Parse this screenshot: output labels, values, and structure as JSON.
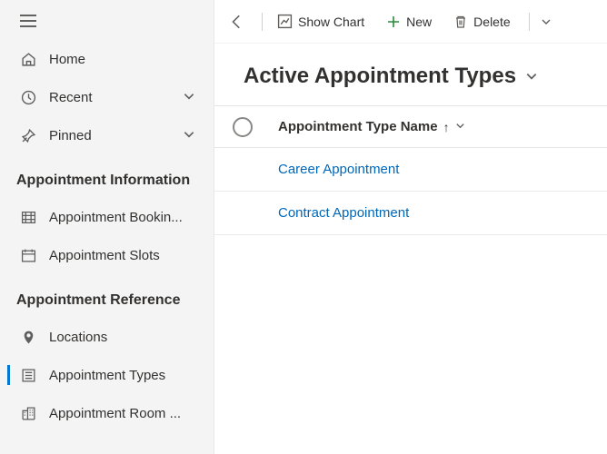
{
  "sidebar": {
    "nav": [
      {
        "label": "Home"
      },
      {
        "label": "Recent"
      },
      {
        "label": "Pinned"
      }
    ],
    "section1": {
      "title": "Appointment Information",
      "items": [
        {
          "label": "Appointment Bookin..."
        },
        {
          "label": "Appointment Slots"
        }
      ]
    },
    "section2": {
      "title": "Appointment Reference",
      "items": [
        {
          "label": "Locations"
        },
        {
          "label": "Appointment Types"
        },
        {
          "label": "Appointment Room ..."
        }
      ]
    }
  },
  "commands": {
    "show_chart": "Show Chart",
    "new": "New",
    "delete": "Delete"
  },
  "view": {
    "title": "Active Appointment Types"
  },
  "grid": {
    "column": "Appointment Type Name",
    "sort": "↑",
    "rows": [
      {
        "name": "Career Appointment"
      },
      {
        "name": "Contract Appointment"
      }
    ]
  }
}
